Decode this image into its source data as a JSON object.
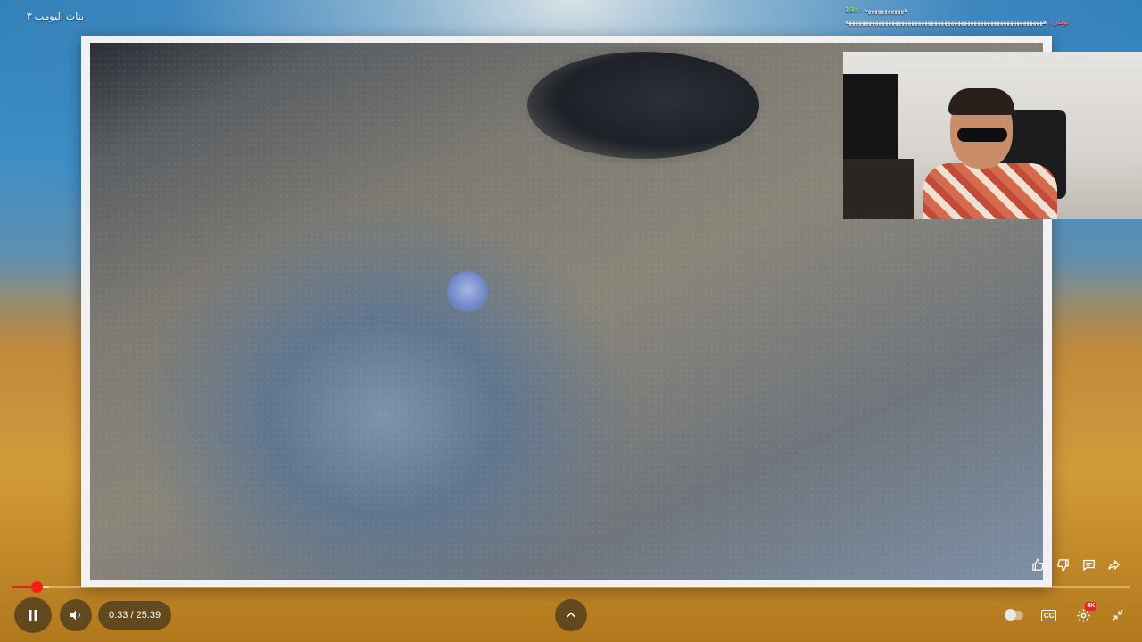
{
  "overlay": {
    "title": "بنات اليومب ٣"
  },
  "chat": [
    {
      "user": "19lx :",
      "message": "ههههههههههههه",
      "color": "#7dff6a"
    },
    {
      "user": "لوللي :",
      "message": "ههههههههههههههههههههههههههههههههههههههههههههههههههههههههههههه",
      "color": "#ff6b8a"
    }
  ],
  "player": {
    "current_time": "0:33",
    "duration": "25:39",
    "time_display": "0:33 / 25:39",
    "progress_fraction": 0.0214,
    "buffered_fraction": 0.033,
    "quality_badge": "4K",
    "captions_label": "CC",
    "accent_color": "#ff1a1a"
  },
  "icons": {
    "play_pause": "pause-icon",
    "volume": "volume-icon",
    "chevron": "chevron-up-icon",
    "autoplay": "autoplay-toggle",
    "captions": "captions-icon",
    "settings": "gear-icon",
    "exit_fullscreen": "exit-fullscreen-icon",
    "like": "thumbs-up-icon",
    "dislike": "thumbs-down-icon",
    "comments": "comment-icon",
    "share": "share-icon"
  }
}
